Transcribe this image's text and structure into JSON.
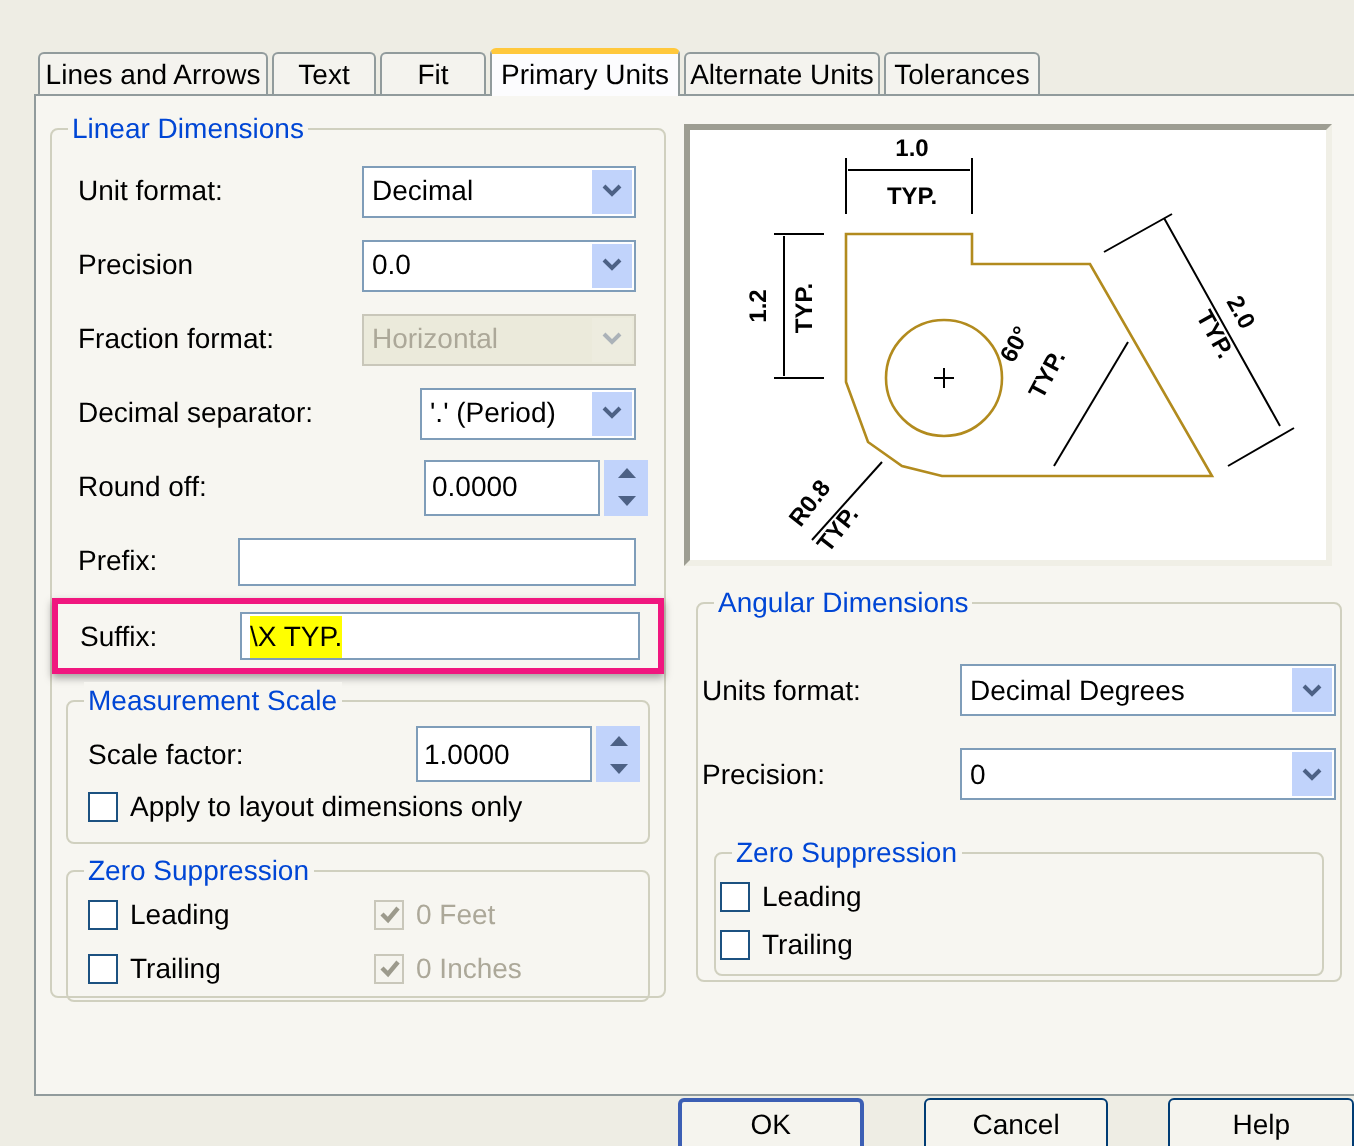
{
  "tabs": [
    {
      "label": "Lines and Arrows",
      "selected": false
    },
    {
      "label": "Text",
      "selected": false
    },
    {
      "label": "Fit",
      "selected": false
    },
    {
      "label": "Primary Units",
      "selected": true
    },
    {
      "label": "Alternate Units",
      "selected": false
    },
    {
      "label": "Tolerances",
      "selected": false
    }
  ],
  "linear_dimensions": {
    "title": "Linear Dimensions",
    "fields": [
      {
        "kind": "select",
        "label": "Unit format:",
        "value": "Decimal",
        "disabled": false
      },
      {
        "kind": "select",
        "label": "Precision",
        "value": "0.0",
        "disabled": false
      },
      {
        "kind": "select",
        "label": "Fraction format:",
        "value": "Horizontal",
        "disabled": true
      },
      {
        "kind": "select",
        "label": "Decimal separator:",
        "value": "'.' (Period)",
        "disabled": false
      },
      {
        "kind": "spinner",
        "label": "Round off:",
        "value": "0.0000"
      },
      {
        "kind": "text",
        "label": "Prefix:"
      },
      {
        "kind": "text",
        "label": "Suffix:",
        "value": "\\X TYP.",
        "text_selected": true,
        "annotated": true
      }
    ],
    "measurement_scale": {
      "title": "Measurement Scale",
      "scale_factor": {
        "label": "Scale factor:",
        "value": "1.0000"
      },
      "layout_only": {
        "label": "Apply to layout dimensions only",
        "checked": false
      }
    },
    "zero_suppression": {
      "title": "Zero Suppression",
      "options": [
        {
          "label": "Leading",
          "checked": false,
          "disabled": false
        },
        {
          "label": "0 Feet",
          "checked": true,
          "disabled": true
        },
        {
          "label": "Trailing",
          "checked": false,
          "disabled": false
        },
        {
          "label": "0 Inches",
          "checked": true,
          "disabled": true
        }
      ]
    }
  },
  "preview": {
    "labels": [
      "1.0",
      "TYP.",
      "1.2",
      "TYP.",
      "2.0",
      "TYP.",
      "60°",
      "TYP.",
      "R0.8",
      "TYP."
    ]
  },
  "angular_dimensions": {
    "title": "Angular Dimensions",
    "fields": [
      {
        "kind": "select",
        "label": "Units format:",
        "value": "Decimal Degrees",
        "disabled": false
      },
      {
        "kind": "select",
        "label": "Precision:",
        "value": "0",
        "disabled": false
      }
    ],
    "zero_suppression": {
      "title": "Zero Suppression",
      "options": [
        {
          "label": "Leading",
          "checked": false,
          "disabled": false
        },
        {
          "label": "Trailing",
          "checked": false,
          "disabled": false
        }
      ]
    }
  },
  "buttons": [
    {
      "label": "OK",
      "default": true
    },
    {
      "label": "Cancel",
      "default": false
    },
    {
      "label": "Help",
      "default": false
    }
  ]
}
